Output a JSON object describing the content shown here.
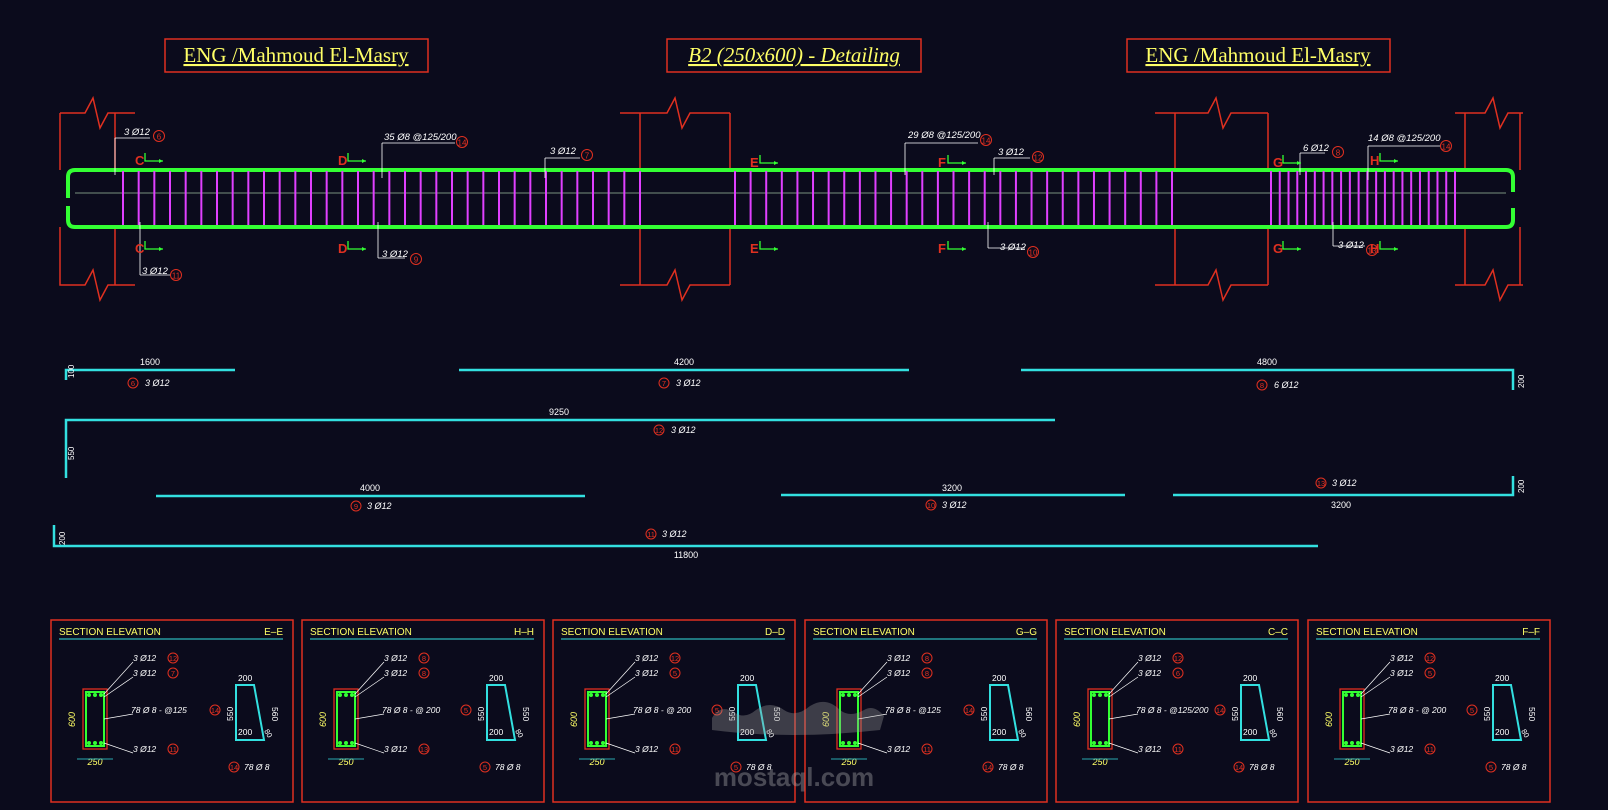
{
  "titles": {
    "left": "ENG /Mahmoud El-Masry",
    "center": "B2 (250x600) - Detailing",
    "right": "ENG /Mahmoud El-Masry"
  },
  "beam_labels": {
    "top_left_bars": "3 Ø12",
    "top_left_mark": "6",
    "stirrups_1": "35 Ø8 @125/200",
    "stirrups_1_mark": "14",
    "top_mid_bars": "3 Ø12",
    "top_mid_mark": "7",
    "bot_left_bars": "3 Ø12",
    "bot_left_mark": "11",
    "bot_mid_bars": "3 Ø12",
    "bot_mid_mark": "9",
    "stirrups_2": "29 Ø8 @125/200",
    "stirrups_2_mark": "14",
    "top_span2_bars": "3 Ø12",
    "top_span2_mark": "12",
    "bot_span2_bars": "3 Ø12",
    "bot_span2_mark": "10",
    "top_span3_bars": "6 Ø12",
    "top_span3_mark": "8",
    "stirrups_3": "14 Ø8 @125/200",
    "stirrups_3_mark": "14",
    "bot_span3_bars": "3 Ø12",
    "bot_span3_mark": "13"
  },
  "section_cuts": [
    "C",
    "D",
    "E",
    "F",
    "G",
    "H"
  ],
  "bars": {
    "b6_len": "1600",
    "b6_hook": "100",
    "b6_mark": "6",
    "b6_label": "3 Ø12",
    "b7_len": "4200",
    "b7_mark": "7",
    "b7_label": "3 Ø12",
    "b8_len": "4800",
    "b8_hook": "200",
    "b8_mark": "8",
    "b8_label": "6 Ø12",
    "b12_len": "9250",
    "b12_hook": "550",
    "b12_mark": "12",
    "b12_label": "3 Ø12",
    "b9_len": "4000",
    "b9_mark": "9",
    "b9_label": "3 Ø12",
    "b10_len": "3200",
    "b10_mark": "10",
    "b10_label": "3 Ø12",
    "b13_len": "3200",
    "b13_hook": "200",
    "b13_mark": "13",
    "b13_label": "3 Ø12",
    "b11_len": "11800",
    "b11_hook": "200",
    "b11_mark": "11",
    "b11_label": "3 Ø12"
  },
  "sections": [
    {
      "title": "SECTION  ELEVATION",
      "cut": "E–E",
      "l1": "3 Ø12",
      "m1": "12",
      "l2": "3 Ø12",
      "m2": "7",
      "stir": "78 Ø 8 - @125",
      "sm": "14",
      "l3": "3 Ø12",
      "m3": "11",
      "w": "250",
      "h": "600",
      "s1": "200",
      "s2": "550",
      "s3": "200",
      "s4": "560",
      "s5": "80",
      "leg": "78  Ø 8",
      "legm": "14"
    },
    {
      "title": "SECTION  ELEVATION",
      "cut": "H–H",
      "l1": "3 Ø12",
      "m1": "8",
      "l2": "3 Ø12",
      "m2": "8",
      "stir": "78 Ø 8 - @ 200",
      "sm": "5",
      "l3": "3 Ø12",
      "m3": "13",
      "w": "250",
      "h": "600",
      "s1": "200",
      "s2": "550",
      "s3": "200",
      "s4": "550",
      "s5": "80",
      "leg": "78  Ø 8",
      "legm": "5"
    },
    {
      "title": "SECTION  ELEVATION",
      "cut": "D–D",
      "l1": "3 Ø12",
      "m1": "12",
      "l2": "3 Ø12",
      "m2": "5",
      "stir": "78 Ø 8 - @ 200",
      "sm": "5",
      "l3": "3 Ø12",
      "m3": "11",
      "w": "250",
      "h": "600",
      "s1": "200",
      "s2": "550",
      "s3": "200",
      "s4": "550",
      "s5": "80",
      "leg": "78  Ø 8",
      "legm": "5"
    },
    {
      "title": "SECTION  ELEVATION",
      "cut": "G–G",
      "l1": "3 Ø12",
      "m1": "8",
      "l2": "3 Ø12",
      "m2": "8",
      "stir": "78 Ø 8 - @125",
      "sm": "14",
      "l3": "3 Ø12",
      "m3": "11",
      "w": "250",
      "h": "600",
      "s1": "200",
      "s2": "550",
      "s3": "200",
      "s4": "560",
      "s5": "80",
      "leg": "78  Ø 8",
      "legm": "14"
    },
    {
      "title": "SECTION  ELEVATION",
      "cut": "C–C",
      "l1": "3 Ø12",
      "m1": "12",
      "l2": "3 Ø12",
      "m2": "6",
      "stir": "78 Ø 8 - @125/200",
      "sm": "14",
      "l3": "3 Ø12",
      "m3": "11",
      "w": "250",
      "h": "600",
      "s1": "200",
      "s2": "550",
      "s3": "200",
      "s4": "560",
      "s5": "80",
      "leg": "78  Ø 8",
      "legm": "14"
    },
    {
      "title": "SECTION  ELEVATION",
      "cut": "F–F",
      "l1": "3 Ø12",
      "m1": "12",
      "l2": "3 Ø12",
      "m2": "5",
      "stir": "78 Ø 8 - @ 200",
      "sm": "5",
      "l3": "3 Ø12",
      "m3": "11",
      "w": "250",
      "h": "600",
      "s1": "200",
      "s2": "550",
      "s3": "200",
      "s4": "550",
      "s5": "80",
      "leg": "78  Ø 8",
      "legm": "5"
    }
  ],
  "watermark": {
    "text": "mostaql.com"
  },
  "colors": {
    "background": "#0b0b1c",
    "columns": "#e03020",
    "beam": "#33ff33",
    "stirrups": "#e040ff",
    "bars": "#33e0e0",
    "text": "#ffffff",
    "title": "#ffff66"
  }
}
